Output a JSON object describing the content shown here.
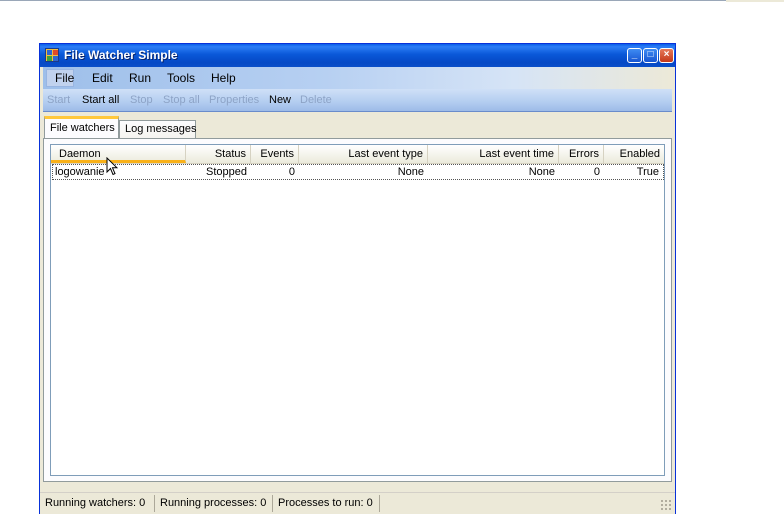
{
  "window": {
    "title": "File Watcher Simple",
    "controls": {
      "minimize": "_",
      "maximize": "□",
      "close": "×"
    }
  },
  "menu": [
    "File",
    "Edit",
    "Run",
    "Tools",
    "Help"
  ],
  "toolbar": {
    "start": "Start",
    "start_all": "Start all",
    "stop": "Stop",
    "stop_all": "Stop all",
    "properties": "Properties",
    "new": "New",
    "delete": "Delete"
  },
  "tabs": [
    "File watchers",
    "Log messages"
  ],
  "list": {
    "columns": [
      "Daemon",
      "Status",
      "Events",
      "Last event type",
      "Last event time",
      "Errors",
      "Enabled"
    ],
    "rows": [
      [
        "logowanie",
        "Stopped",
        "0",
        "None",
        "None",
        "0",
        "True"
      ]
    ]
  },
  "status": {
    "running_watchers": "Running watchers:  0",
    "running_processes": "Running processes:  0",
    "processes_to_run": "Processes to run:  0"
  },
  "colors": {
    "titlebar": "#0a58d8",
    "menubar": "#b7d0f2",
    "sort_indicator": "#f9b119"
  },
  "icons": [
    "app-icon",
    "minimize-icon",
    "maximize-icon",
    "close-icon",
    "mouse-cursor-icon",
    "resize-grip-icon"
  ]
}
